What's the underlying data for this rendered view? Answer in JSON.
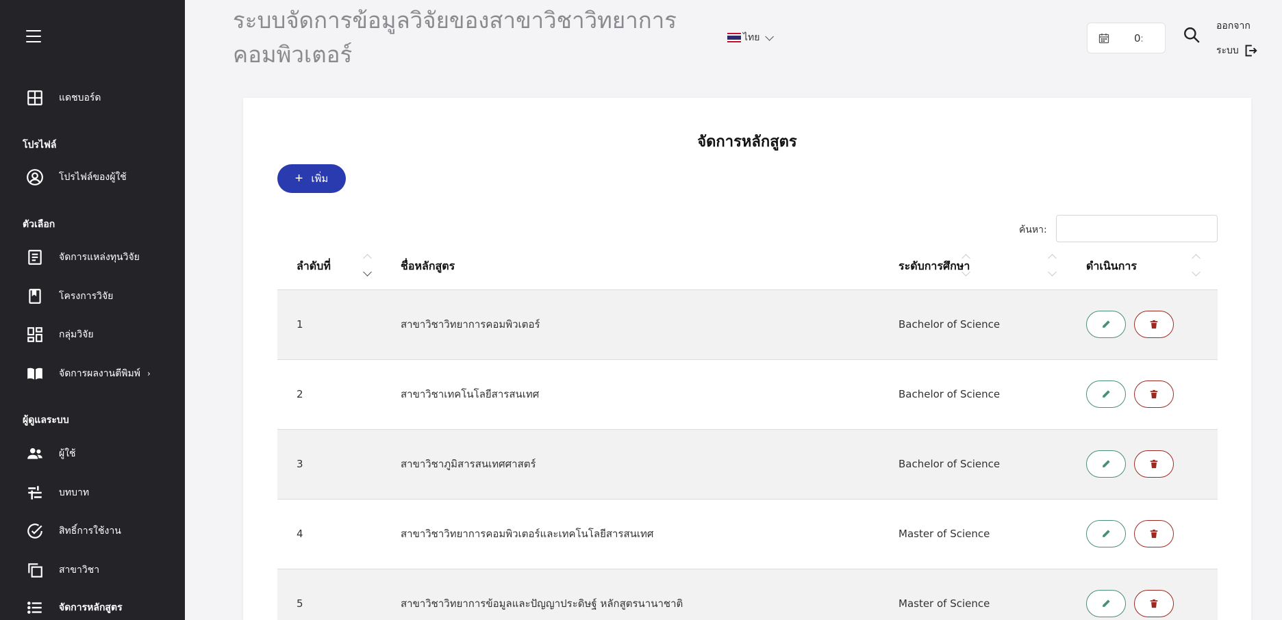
{
  "app": {
    "title": "ระบบจัดการข้อมูลวิจัยของสาขาวิชาวิทยาการคอมพิวเตอร์"
  },
  "header": {
    "language": "ไทย",
    "date_value": "0:",
    "logout_line1": "ออกจาก",
    "logout_line2": "ระบบ"
  },
  "sidebar": {
    "items": [
      {
        "label": "แดชบอร์ด",
        "icon": "dashboard-icon"
      },
      {
        "section": "โปรไฟล์"
      },
      {
        "label": "โปรไฟล์ของผู้ใช้",
        "icon": "user-circle-icon"
      },
      {
        "section": "ตัวเลือก"
      },
      {
        "label": "จัดการแหล่งทุนวิจัย",
        "icon": "document-icon"
      },
      {
        "label": "โครงการวิจัย",
        "icon": "bookmark-icon"
      },
      {
        "label": "กลุ่มวิจัย",
        "icon": "layout-icon"
      },
      {
        "label": "จัดการผลงานตีพิมพ์",
        "icon": "book-open-icon",
        "chevron": "›"
      },
      {
        "section": "ผู้ดูแลระบบ"
      },
      {
        "label": "ผู้ใช้",
        "icon": "users-icon"
      },
      {
        "label": "บทบาท",
        "icon": "roles-icon"
      },
      {
        "label": "สิทธิ์การใช้งาน",
        "icon": "check-circle-icon"
      },
      {
        "label": "สาขาวิชา",
        "icon": "copy-icon"
      },
      {
        "label": "จัดการหลักสูตร",
        "icon": "list-icon"
      }
    ]
  },
  "main": {
    "title": "จัดการหลักสูตร",
    "add_label": "เพิ่ม",
    "search_label": "ค้นหา:",
    "search_value": "",
    "columns": [
      "ลำดับที่",
      "ชื่อหลักสูตร",
      "ระดับการศึกษา",
      "ดำเนินการ"
    ],
    "rows": [
      {
        "no": "1",
        "name": "สาขาวิชาวิทยาการคอมพิวเตอร์",
        "level": "Bachelor of Science"
      },
      {
        "no": "2",
        "name": "สาขาวิชาเทคโนโลยีสารสนเทศ",
        "level": "Bachelor of Science"
      },
      {
        "no": "3",
        "name": "สาขาวิชาภูมิสารสนเทศศาสตร์",
        "level": "Bachelor of Science"
      },
      {
        "no": "4",
        "name": "สาขาวิชาวิทยาการคอมพิวเตอร์และเทคโนโลยีสารสนเทศ",
        "level": "Master of Science"
      },
      {
        "no": "5",
        "name": "สาขาวิชาวิทยาการข้อมูลและปัญญาประดิษฐ์ หลักสูตรนานาชาติ",
        "level": "Master of Science"
      }
    ]
  },
  "colors": {
    "sidebar_bg": "#242328",
    "primary": "#2a3bb0",
    "edit": "#4a8d78",
    "delete": "#9b2a22"
  }
}
